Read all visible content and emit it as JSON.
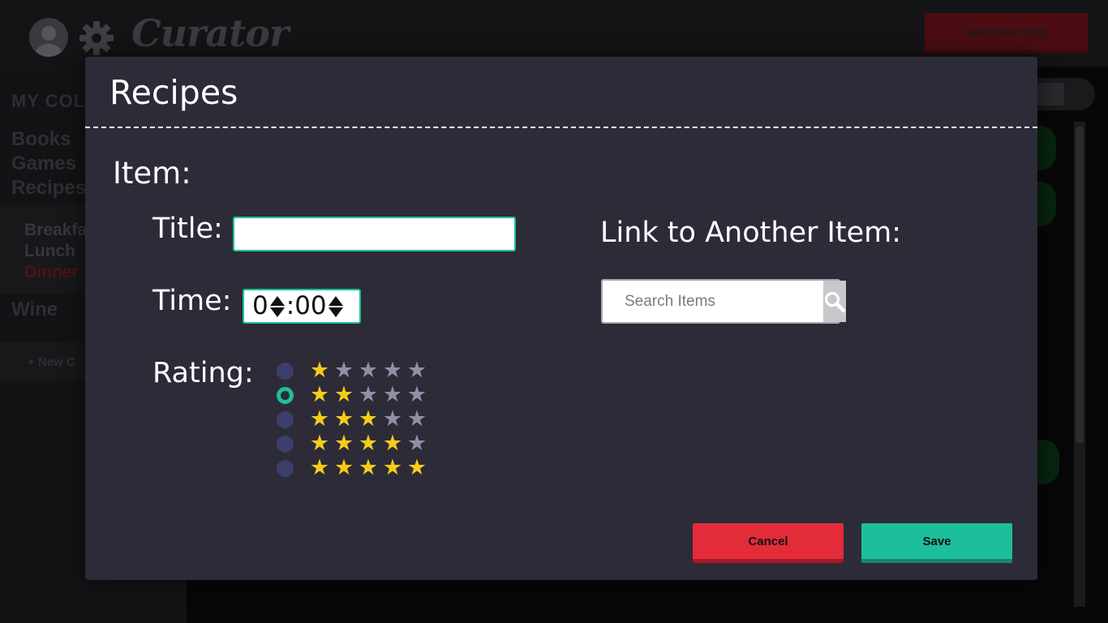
{
  "background": {
    "logo": "Curator",
    "add_button_label": "Add New Item",
    "sidebar": {
      "title": "MY COL",
      "items": [
        "Books",
        "Games",
        "Recipes",
        "Wine"
      ],
      "subitems": [
        "Breakfa",
        "Lunch",
        "Dinner"
      ],
      "new_label": "+ New C"
    }
  },
  "modal": {
    "title": "Recipes",
    "section_label": "Item:",
    "title_field": {
      "label": "Title:",
      "value": ""
    },
    "time_field": {
      "label": "Time:",
      "hours": "0",
      "separator": ":",
      "minutes": "00"
    },
    "rating": {
      "label": "Rating:",
      "selected": 2,
      "max": 5,
      "options": [
        1,
        2,
        3,
        4,
        5
      ]
    },
    "link": {
      "label": "Link to Another Item:",
      "search_placeholder": "Search Items",
      "search_icon": "search-icon"
    },
    "buttons": {
      "cancel": "Cancel",
      "save": "Save"
    }
  },
  "colors": {
    "accent": "#1dbf9a",
    "danger": "#e42b3a",
    "star_on": "#f5cc1c",
    "star_off": "#8f90a8",
    "modal_bg": "#2d2b38"
  }
}
